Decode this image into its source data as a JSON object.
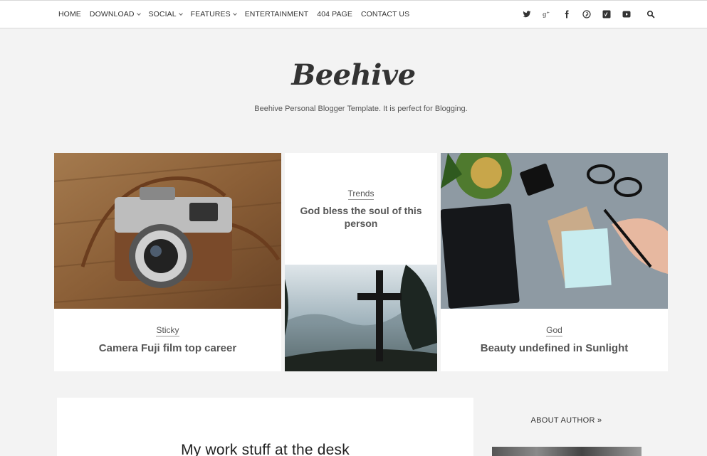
{
  "nav": {
    "items": [
      {
        "label": "HOME",
        "dropdown": false
      },
      {
        "label": "DOWNLOAD",
        "dropdown": true
      },
      {
        "label": "SOCIAL",
        "dropdown": true
      },
      {
        "label": "FEATURES",
        "dropdown": true
      },
      {
        "label": "ENTERTAINMENT",
        "dropdown": false
      },
      {
        "label": "404 PAGE",
        "dropdown": false
      },
      {
        "label": "CONTACT US",
        "dropdown": false
      }
    ],
    "social_icons": [
      "twitter-icon",
      "google-plus-icon",
      "facebook-icon",
      "pinterest-icon",
      "vimeo-icon",
      "youtube-icon"
    ],
    "search_icon": "search-icon"
  },
  "header": {
    "brand": "Beehive",
    "tagline": "Beehive Personal Blogger Template. It is perfect for Blogging."
  },
  "featured": {
    "left": {
      "category": "Sticky",
      "title": "Camera Fuji film top career"
    },
    "middle": {
      "category": "Trends",
      "title": "God bless the soul of this person"
    },
    "right": {
      "category": "God",
      "title": "Beauty undefined in Sunlight"
    }
  },
  "main_post": {
    "title": "My work stuff at the desk"
  },
  "sidebar": {
    "about_label": "ABOUT AUTHOR »"
  },
  "colors": {
    "background": "#f3f3f3",
    "card": "#ffffff",
    "text": "#333333"
  }
}
